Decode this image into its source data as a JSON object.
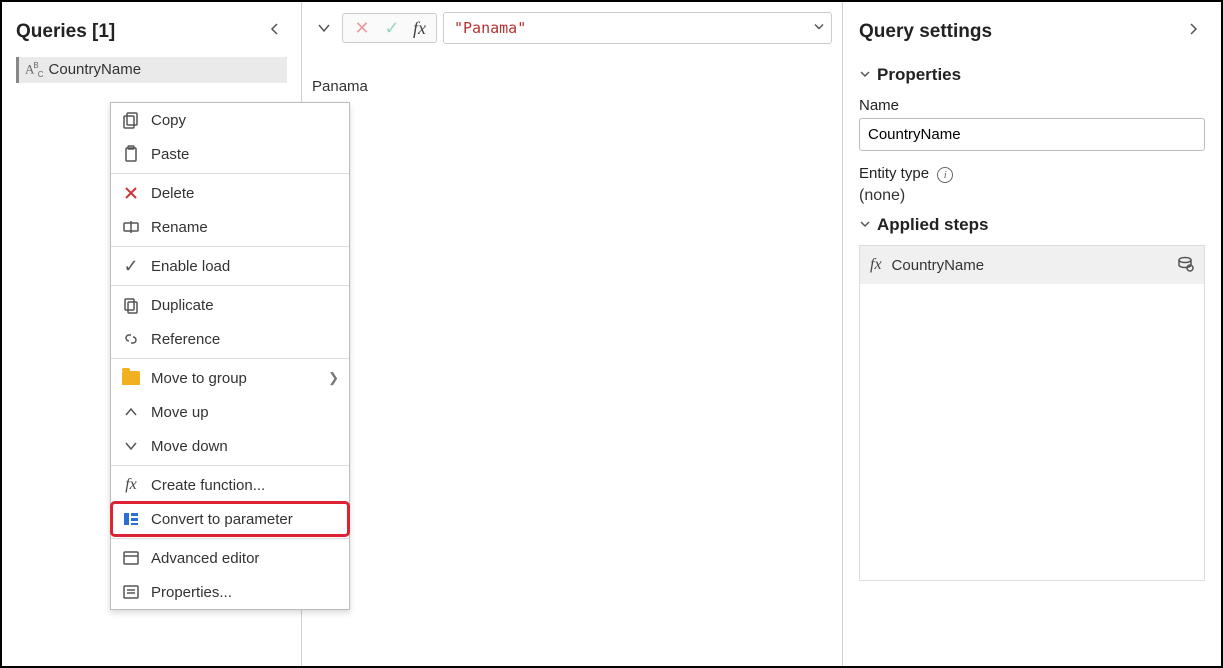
{
  "queries": {
    "header": "Queries [1]",
    "items": [
      {
        "icon": "abc-icon",
        "name": "CountryName"
      }
    ]
  },
  "context_menu": {
    "groups": [
      [
        {
          "icon": "copy-icon",
          "label": "Copy"
        },
        {
          "icon": "paste-icon",
          "label": "Paste"
        }
      ],
      [
        {
          "icon": "delete-icon",
          "label": "Delete"
        },
        {
          "icon": "rename-icon",
          "label": "Rename"
        }
      ],
      [
        {
          "icon": "check-icon",
          "label": "Enable load"
        }
      ],
      [
        {
          "icon": "duplicate-icon",
          "label": "Duplicate"
        },
        {
          "icon": "reference-icon",
          "label": "Reference"
        }
      ],
      [
        {
          "icon": "folder-icon",
          "label": "Move to group",
          "submenu": true
        },
        {
          "icon": "move-up-icon",
          "label": "Move up"
        },
        {
          "icon": "move-down-icon",
          "label": "Move down"
        }
      ],
      [
        {
          "icon": "fx-icon",
          "label": "Create function..."
        },
        {
          "icon": "parameter-icon",
          "label": "Convert to parameter",
          "highlighted": true
        }
      ],
      [
        {
          "icon": "advanced-icon",
          "label": "Advanced editor"
        },
        {
          "icon": "properties-icon",
          "label": "Properties..."
        }
      ]
    ]
  },
  "formula_bar": {
    "value": "\"Panama\""
  },
  "preview_value": "Panama",
  "settings": {
    "header": "Query settings",
    "properties": {
      "title": "Properties",
      "name_label": "Name",
      "name_value": "CountryName",
      "entity_label": "Entity type",
      "entity_value": "(none)"
    },
    "steps": {
      "title": "Applied steps",
      "items": [
        {
          "label": "CountryName"
        }
      ]
    }
  }
}
